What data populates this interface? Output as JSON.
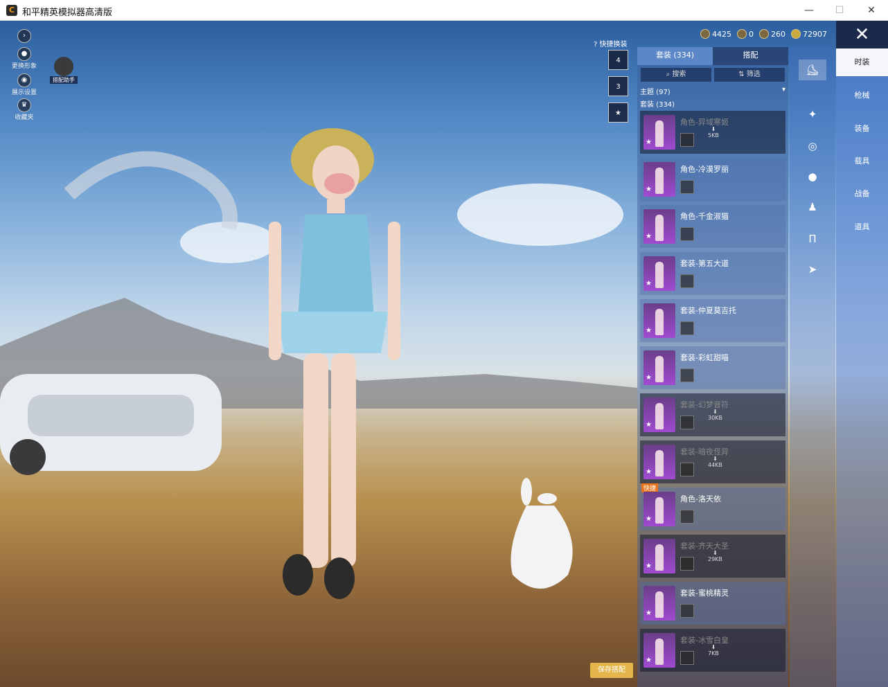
{
  "window": {
    "title": "和平精英模拟器高清版",
    "icon": "C",
    "min": "—",
    "max": "☐",
    "close": "✕"
  },
  "left": {
    "nav_icon": "nav-arrow-icon",
    "change_avatar": "更换形象",
    "display_settings": "展示设置",
    "assistant": "搭配助手",
    "favorite": "收藏夹"
  },
  "currency": [
    {
      "icon": "coin-icon",
      "value": "4425"
    },
    {
      "icon": "token-icon",
      "value": "0"
    },
    {
      "icon": "badge-icon",
      "value": "260"
    },
    {
      "icon": "gold-icon",
      "value": "72907"
    }
  ],
  "quick_swap": {
    "label": "快捷换装",
    "slots": [
      "4",
      "3",
      "★"
    ]
  },
  "panel": {
    "tabs": [
      "套装 (334)",
      "搭配"
    ],
    "search": "搜索",
    "filter": "筛选",
    "theme": "主题 (97)",
    "outfits": "套装 (334)"
  },
  "items": [
    {
      "name": "角色-异域寒姬",
      "downloaded": false,
      "size": "5KB"
    },
    {
      "name": "角色-冷漠罗丽",
      "downloaded": true,
      "size": ""
    },
    {
      "name": "角色-千金淑猫",
      "downloaded": true,
      "size": ""
    },
    {
      "name": "套装-第五大道",
      "downloaded": true,
      "size": ""
    },
    {
      "name": "套装-仲夏莫吉托",
      "downloaded": true,
      "size": ""
    },
    {
      "name": "套装-彩虹甜喵",
      "downloaded": true,
      "size": ""
    },
    {
      "name": "套装-幻梦音符",
      "downloaded": false,
      "size": "30KB"
    },
    {
      "name": "套装-暗夜怪异",
      "downloaded": false,
      "size": "44KB"
    },
    {
      "name": "角色-洛天依",
      "downloaded": true,
      "size": "",
      "badge": "快捷"
    },
    {
      "name": "套装-齐天大圣",
      "downloaded": false,
      "size": "29KB"
    },
    {
      "name": "套装-蜜桃精灵",
      "downloaded": true,
      "size": ""
    },
    {
      "name": "套装-冰雪白皇",
      "downloaded": false,
      "size": "7KB"
    }
  ],
  "categories_icons": [
    "outfit-icon",
    "weapon-icon",
    "glasses-icon",
    "pet-icon",
    "figure-icon",
    "pants-icon",
    "gun-icon"
  ],
  "sidebar": [
    "时装",
    "枪械",
    "装备",
    "载具",
    "战备",
    "道具"
  ],
  "save_button": "保存搭配"
}
